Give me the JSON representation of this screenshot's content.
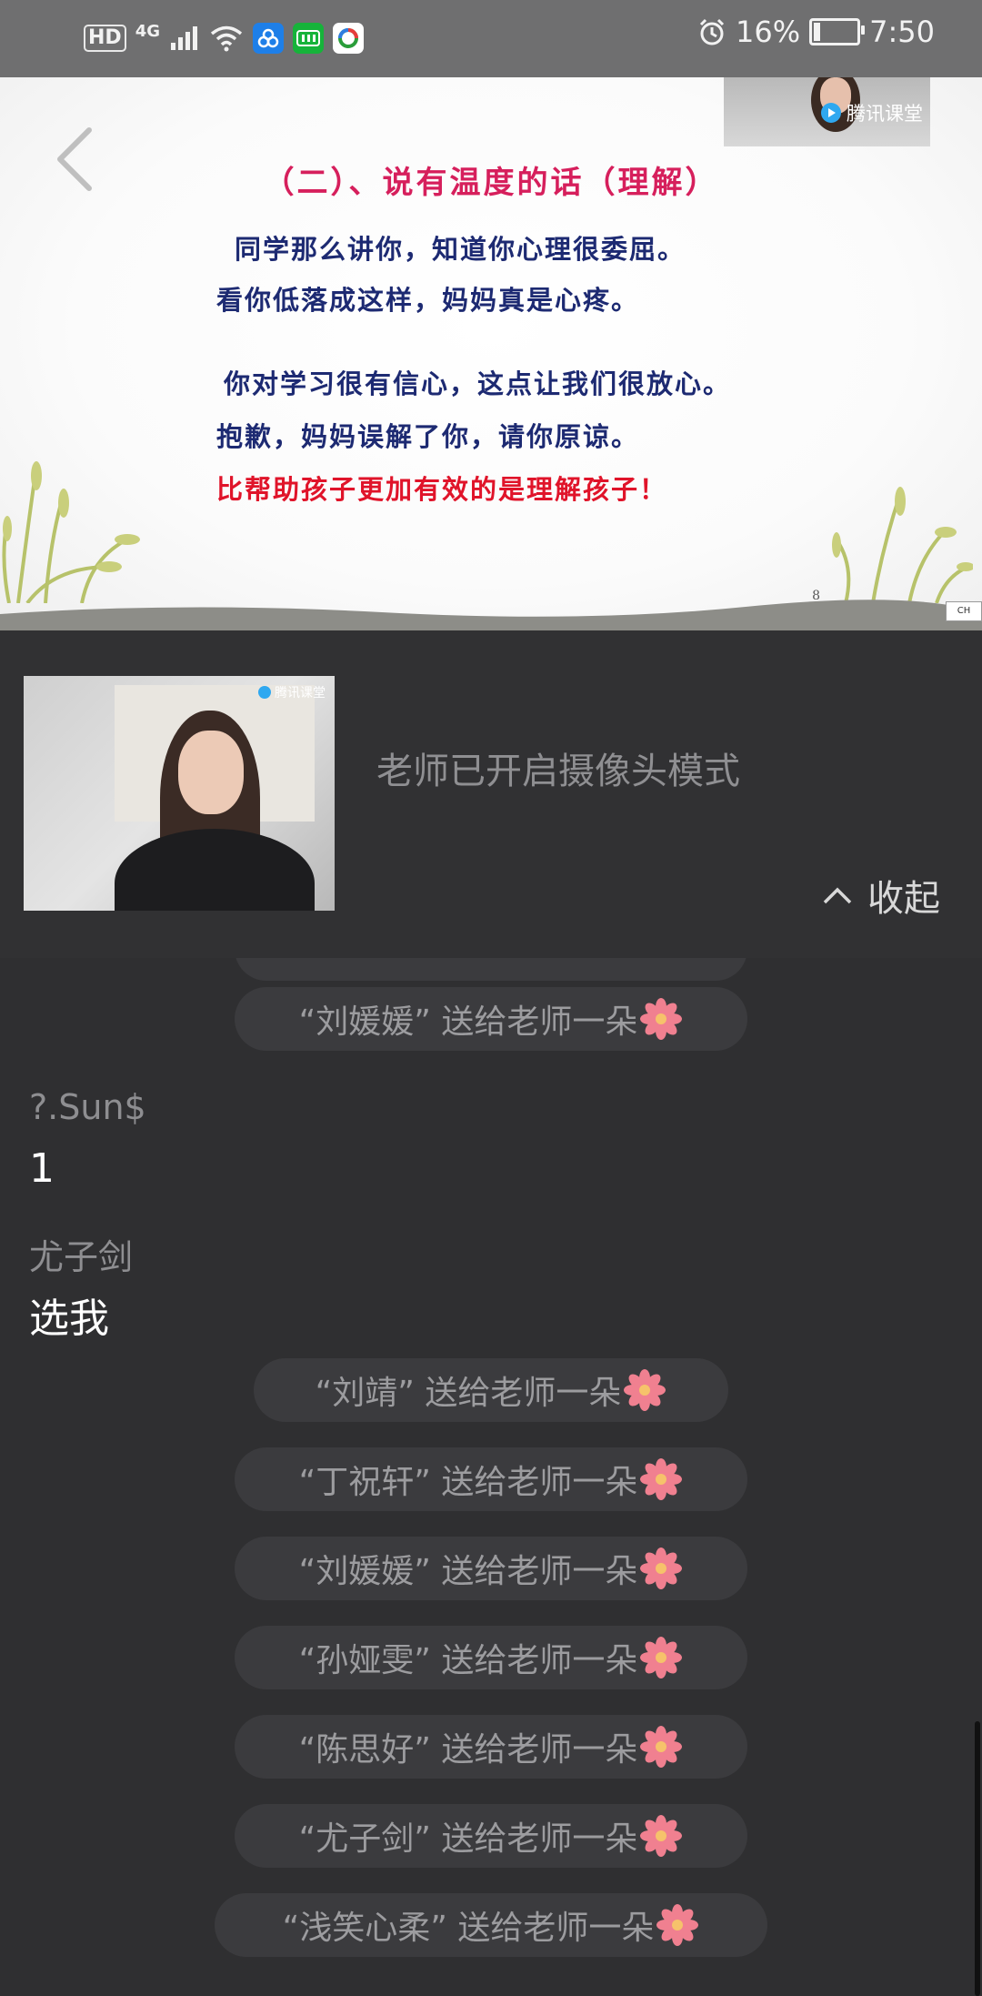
{
  "status_bar": {
    "hd": "HD",
    "network": "4G",
    "battery": "16%",
    "time": "7:50",
    "battery_level": 0.16
  },
  "slide": {
    "title": "（二）、说有温度的话（理解）",
    "lines": [
      "同学那么讲你，知道你心理很委屈。",
      "看你低落成这样，妈妈真是心疼。",
      "你对学习很有信心，这点让我们很放心。",
      "抱歉，妈妈误解了你，请你原谅。",
      "比帮助孩子更加有效的是理解孩子！"
    ],
    "page_number": "8",
    "corner_badge": "CH"
  },
  "camera_thumb": {
    "label": "腾讯课堂"
  },
  "teacher_panel": {
    "watermark": "腾讯课堂",
    "mode_text": "老师已开启摄像头模式",
    "collapse_label": "收起"
  },
  "chat": {
    "gifts_top": [
      {
        "text": "“刘媛媛” 送给老师一朵"
      }
    ],
    "messages": [
      {
        "name": "?.Sun$",
        "text": "1"
      },
      {
        "name": "尤子剑",
        "text": "选我"
      }
    ],
    "gifts": [
      {
        "text": "“刘靖” 送给老师一朵"
      },
      {
        "text": "“丁祝轩” 送给老师一朵"
      },
      {
        "text": "“刘媛媛” 送给老师一朵"
      },
      {
        "text": "“孙娅雯” 送给老师一朵"
      },
      {
        "text": "“陈思好” 送给老师一朵"
      },
      {
        "text": "“尤子剑” 送给老师一朵"
      },
      {
        "text": "“浅笑心柔” 送给老师一朵"
      }
    ],
    "gift_icon": "flower-icon"
  },
  "colors": {
    "background": "#2f2f31",
    "slide_title": "#d61f5c",
    "slide_text": "#1d2a72",
    "slide_highlight": "#e0142a",
    "gift_pill": "#3b3b3e",
    "flower": "#f08090"
  }
}
